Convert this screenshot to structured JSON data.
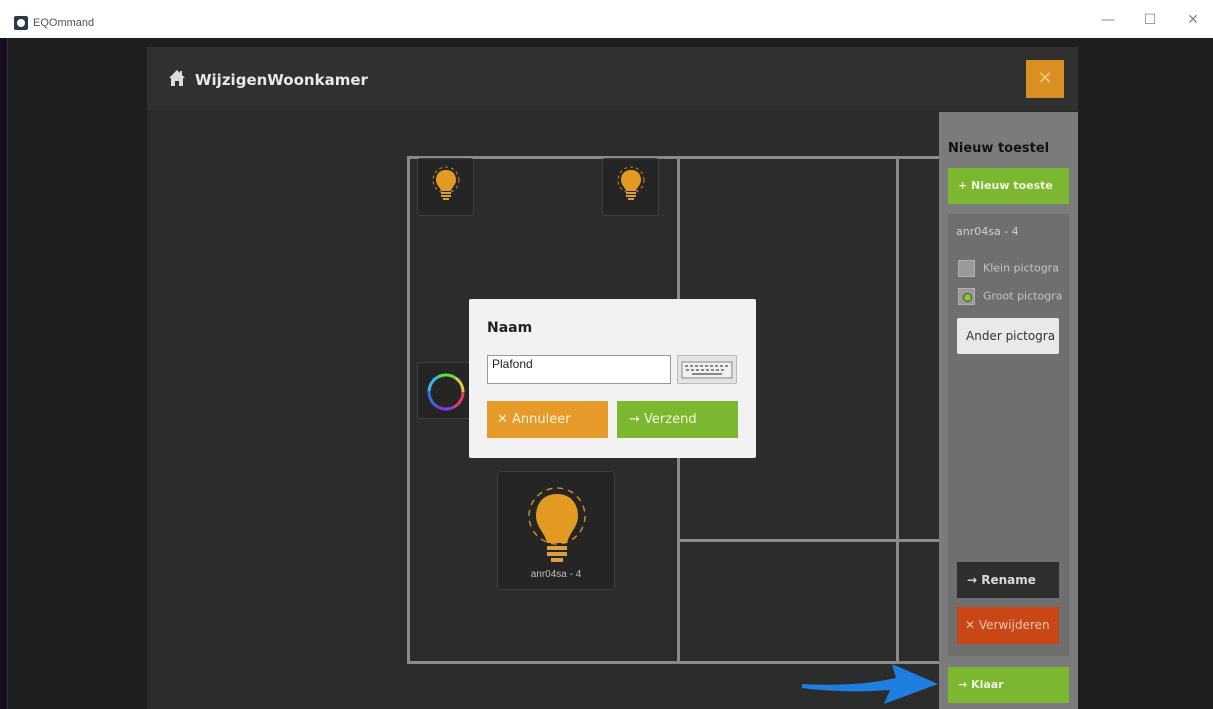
{
  "window": {
    "title": "EQOmmand",
    "controls": [
      "—",
      "☐",
      "✕"
    ]
  },
  "header": {
    "title": "WijzigenWoonkamer",
    "home_icon": "home-icon",
    "close_icon": "close-icon",
    "close_glyph": "✕"
  },
  "room": {
    "tiles": [
      {
        "icon": "bulb-icon",
        "label": ""
      },
      {
        "icon": "bulb-icon",
        "label": ""
      },
      {
        "icon": "color-ring-icon",
        "label": ""
      },
      {
        "icon": "bulb-icon",
        "label": "anr04sa - 4"
      }
    ]
  },
  "sidebar": {
    "title": "Nieuw toestel",
    "new_device_label": "+ Nieuw toeste",
    "device_name": "anr04sa - 4",
    "options": [
      {
        "label": "Klein pictogra",
        "checked": false
      },
      {
        "label": "Groot pictogra",
        "checked": true
      }
    ],
    "other_icon_label": "Ander pictogra",
    "rename_label": "→  Rename",
    "delete_label": "✕ Verwijderen",
    "done_label": "→  Klaar"
  },
  "dialog": {
    "title": "Naam",
    "input_value": "Plafond",
    "keyboard_icon": "keyboard-icon",
    "cancel_label": "✕  Annuleer",
    "send_label": "→  Verzend"
  },
  "colors": {
    "accent_orange": "#d98f21",
    "accent_green": "#7cb82f",
    "danger": "#c94717",
    "pointer_arrow": "#1e7fe0"
  }
}
